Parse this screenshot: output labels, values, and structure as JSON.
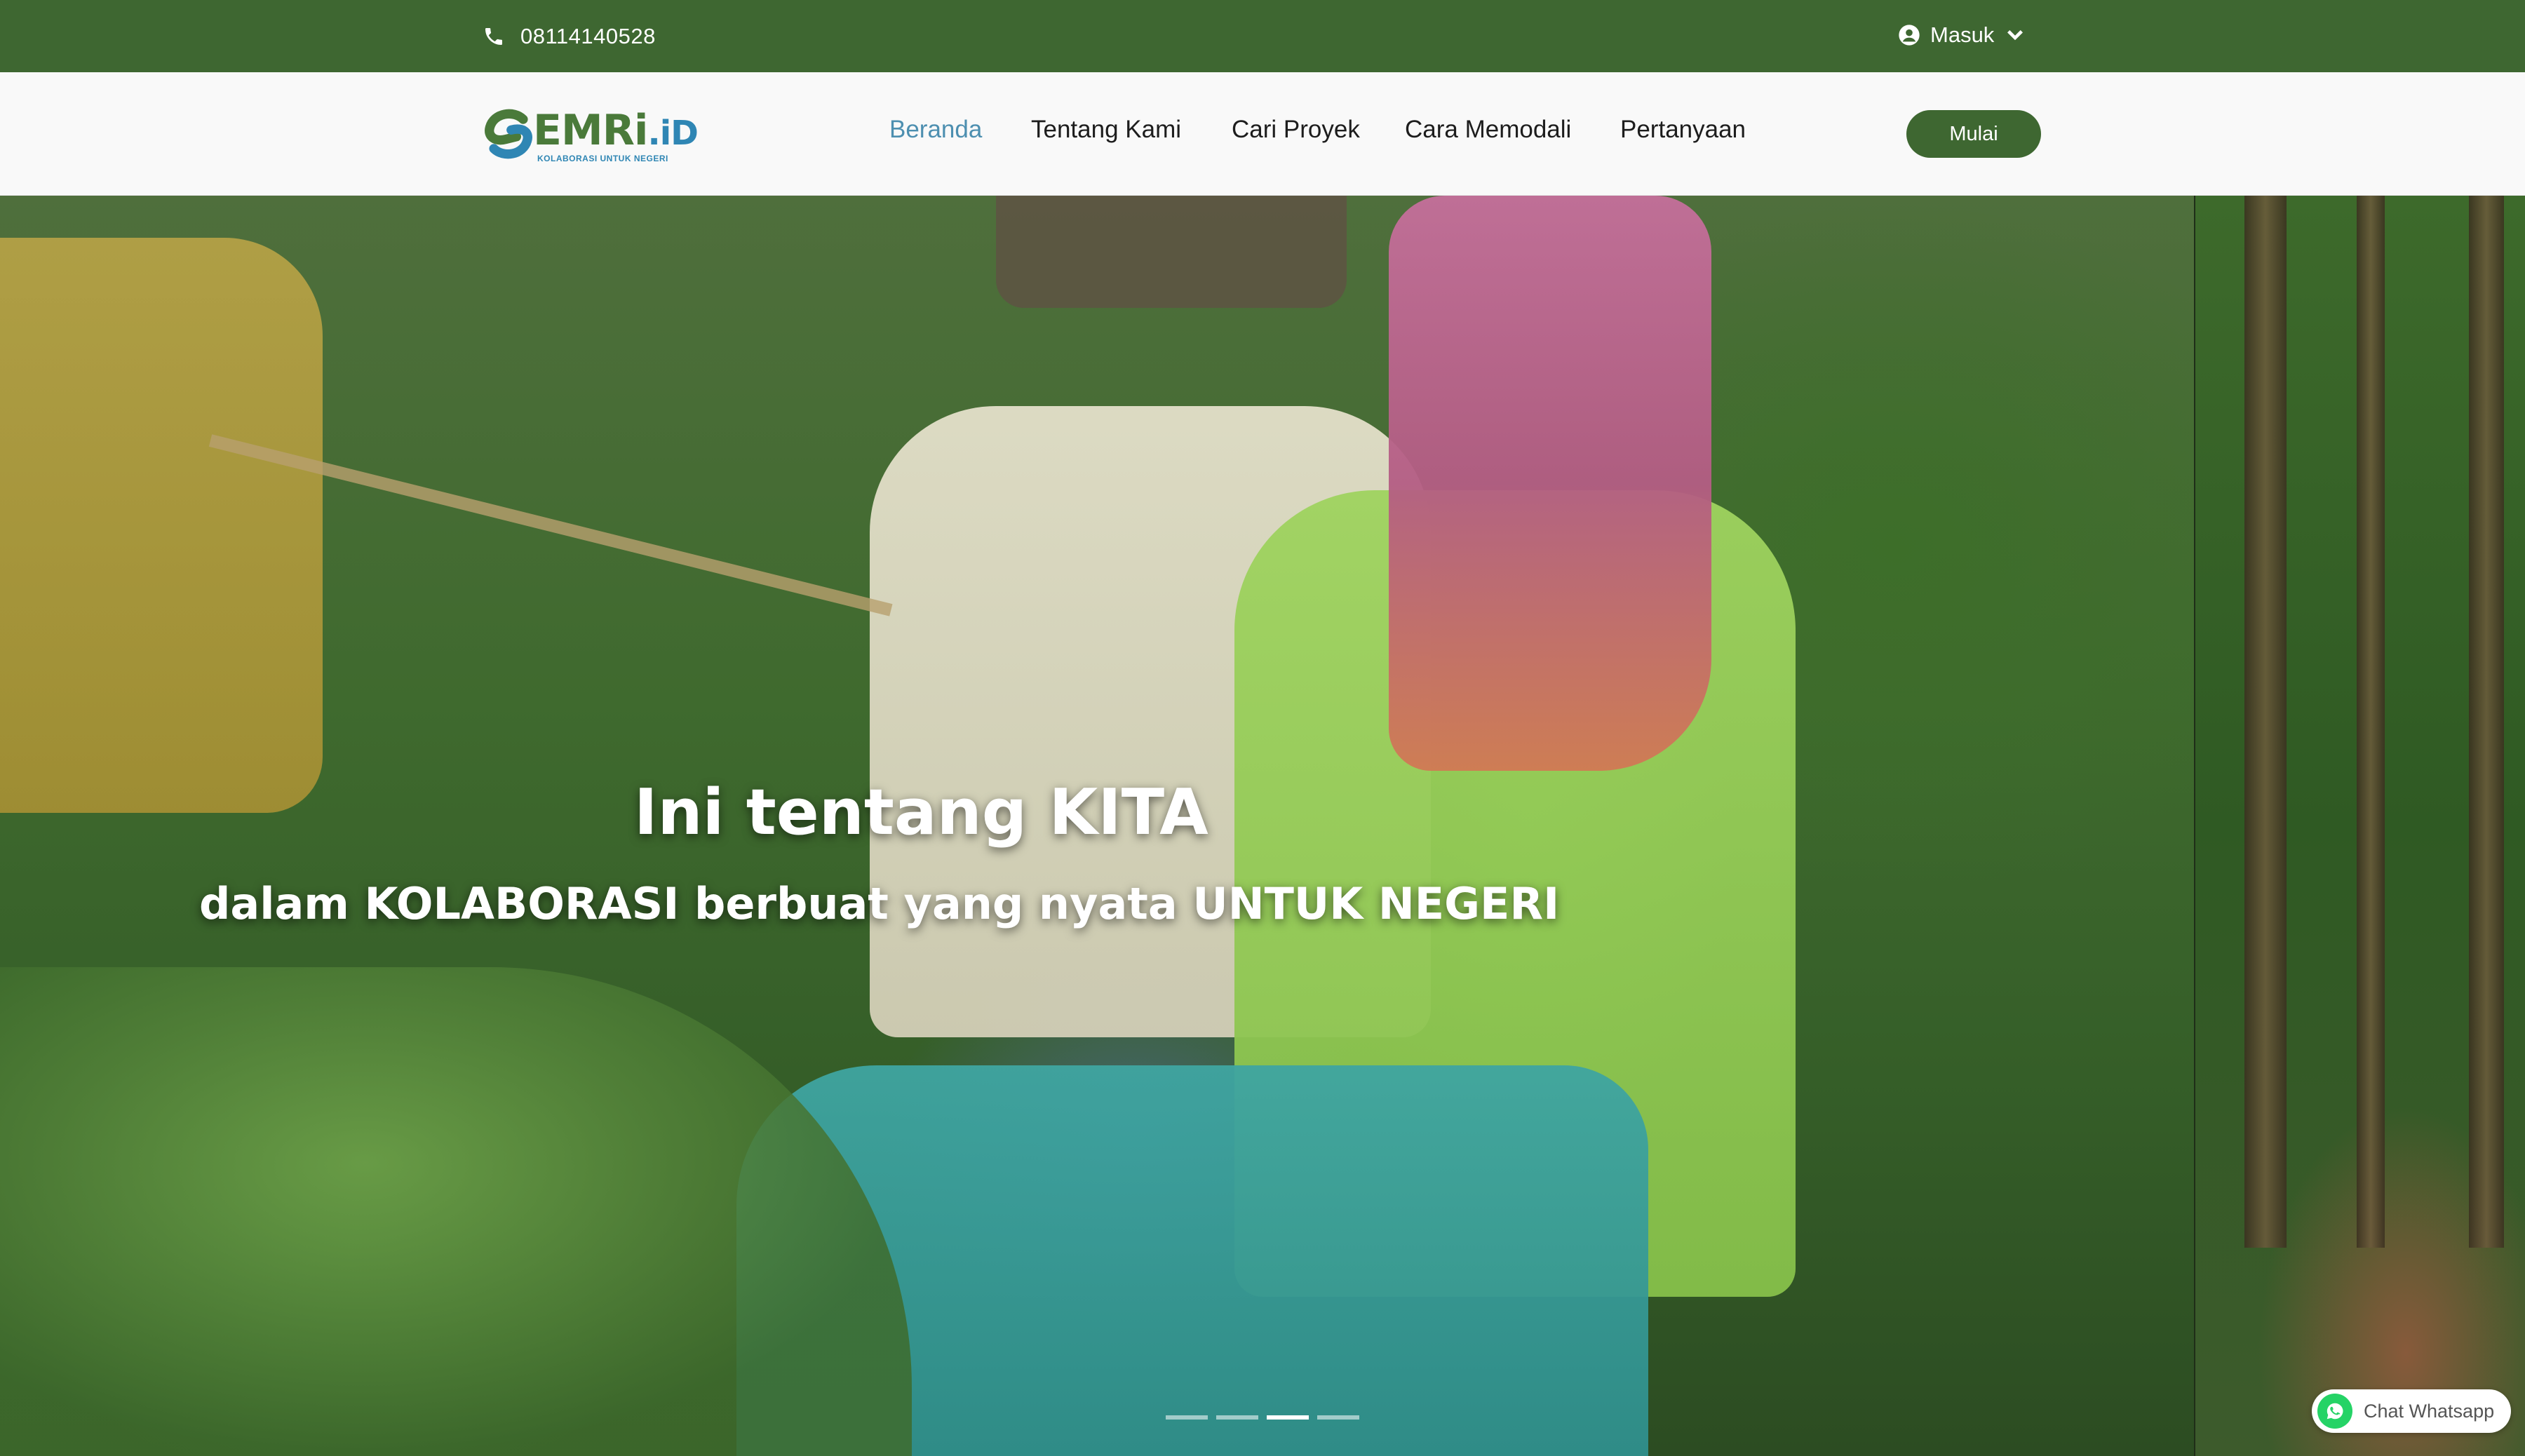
{
  "topbar": {
    "phone_icon": "phone-icon",
    "phone": "08114140528",
    "login_icon": "user-circle-icon",
    "login_label": "Masuk",
    "login_chevron": "chevron-down-icon"
  },
  "brand": {
    "logo_text": "EMRi",
    "logo_suffix": ".iD",
    "logo_tagline": "KOLABORASI UNTUK NEGERI"
  },
  "nav": {
    "items": [
      {
        "label": "Beranda",
        "active": true
      },
      {
        "label": "Tentang Kami",
        "active": false
      },
      {
        "label": "Cari Proyek",
        "active": false
      },
      {
        "label": "Cara Memodali",
        "active": false
      },
      {
        "label": "Pertanyaan",
        "active": false
      }
    ],
    "cta_label": "Mulai"
  },
  "hero": {
    "title": "Ini tentang KITA",
    "subtitle": "dalam KOLABORASI berbuat yang nyata UNTUK NEGERI",
    "slides_count": 4,
    "active_slide": 3
  },
  "whatsapp": {
    "icon": "whatsapp-icon",
    "label": "Chat Whatsapp"
  },
  "colors": {
    "brand_green": "#3e6731",
    "active_link": "#4d8fb0",
    "logo_blue": "#2f86b4"
  }
}
